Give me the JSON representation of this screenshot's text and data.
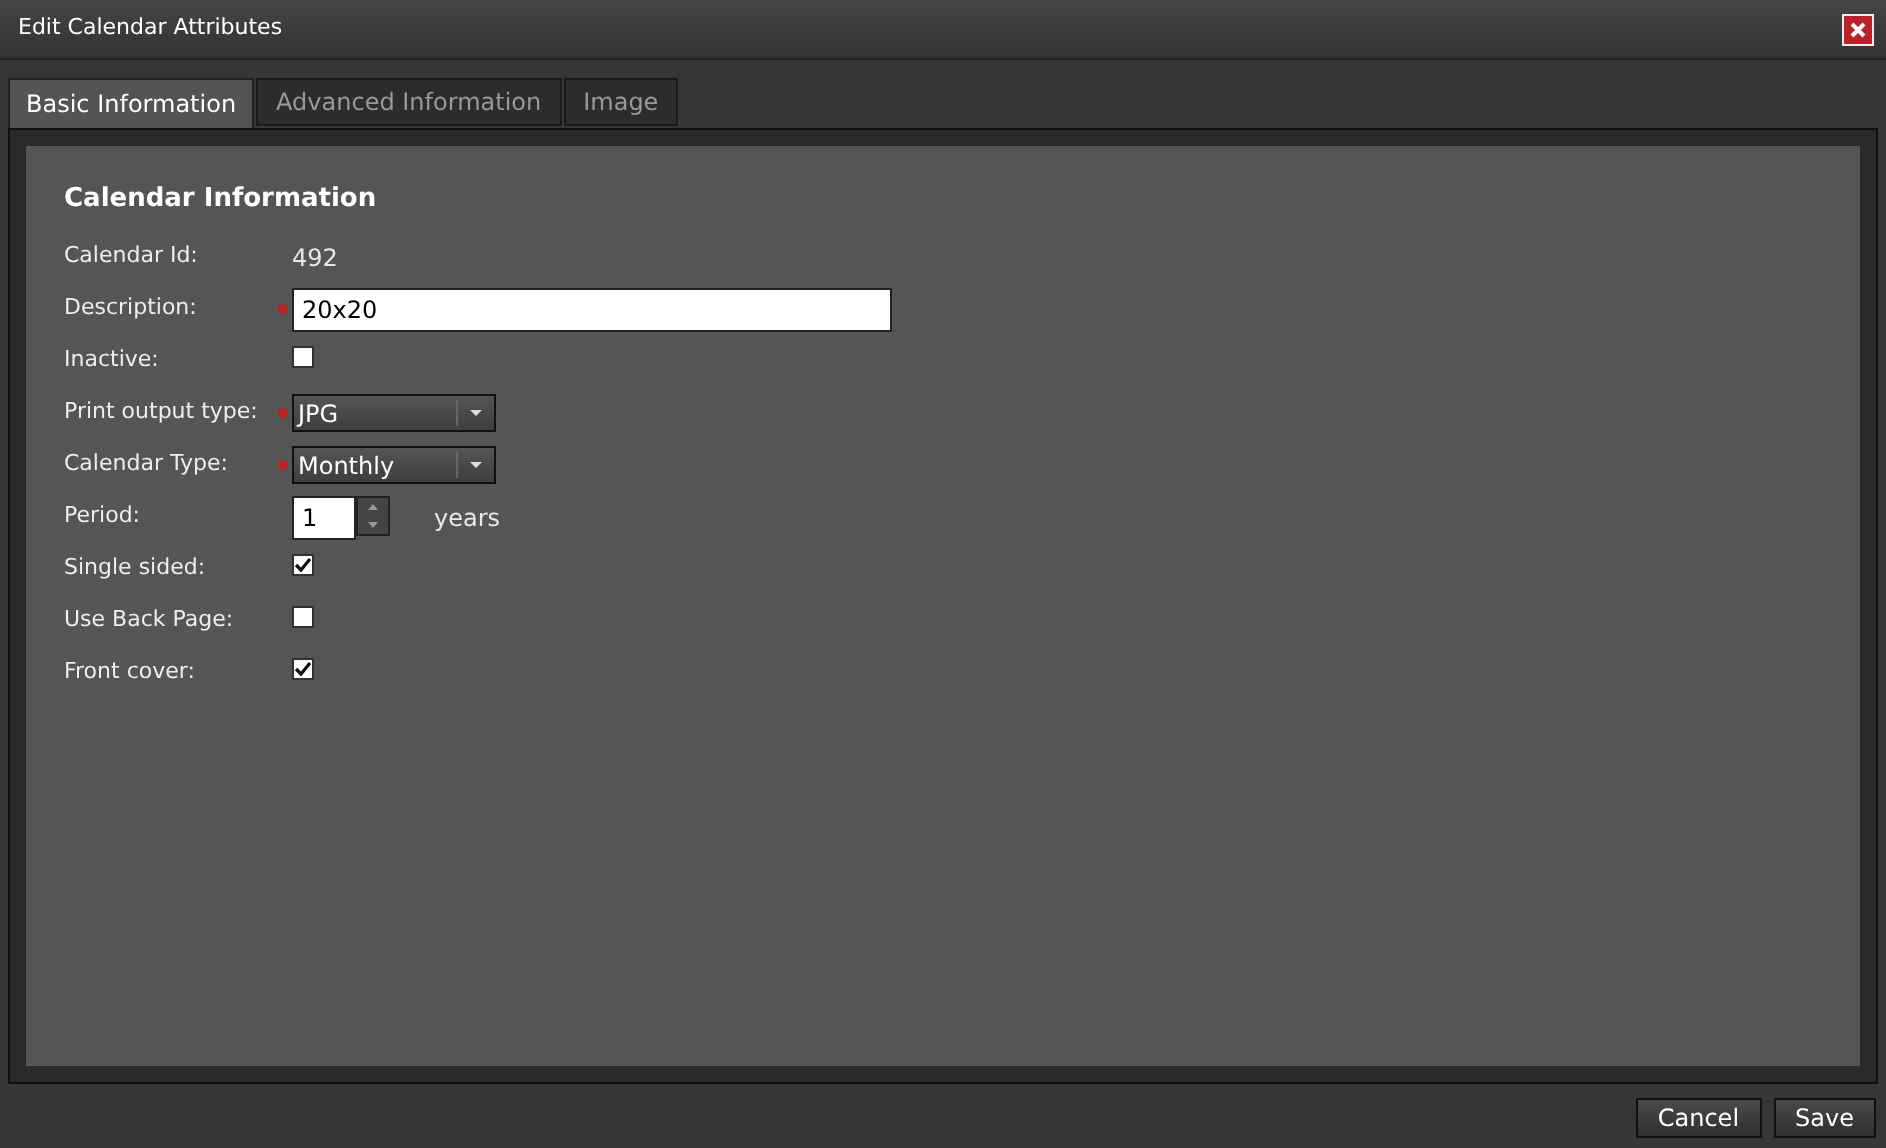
{
  "window": {
    "title": "Edit Calendar Attributes"
  },
  "tabs": [
    {
      "label": "Basic Information",
      "selected": true
    },
    {
      "label": "Advanced Information",
      "selected": false
    },
    {
      "label": "Image",
      "selected": false
    }
  ],
  "section": {
    "title": "Calendar Information"
  },
  "fields": [
    {
      "kind": "text",
      "label": "Calendar Id:",
      "value": "492",
      "required": false
    },
    {
      "kind": "input",
      "label": "Description:",
      "value": "20x20",
      "required": true
    },
    {
      "kind": "checkbox",
      "label": "Inactive:",
      "checked": false,
      "required": false
    },
    {
      "kind": "select",
      "label": "Print output type:",
      "value": "JPG",
      "required": true
    },
    {
      "kind": "select",
      "label": "Calendar Type:",
      "value": "Monthly",
      "required": true
    },
    {
      "kind": "spinner",
      "label": "Period:",
      "value": "1",
      "unit": "years",
      "required": false
    },
    {
      "kind": "checkbox",
      "label": "Single sided:",
      "checked": true,
      "required": false
    },
    {
      "kind": "checkbox",
      "label": "Use Back Page:",
      "checked": false,
      "required": false
    },
    {
      "kind": "checkbox",
      "label": "Front cover:",
      "checked": true,
      "required": false
    }
  ],
  "buttons": [
    "Cancel",
    "Save"
  ]
}
